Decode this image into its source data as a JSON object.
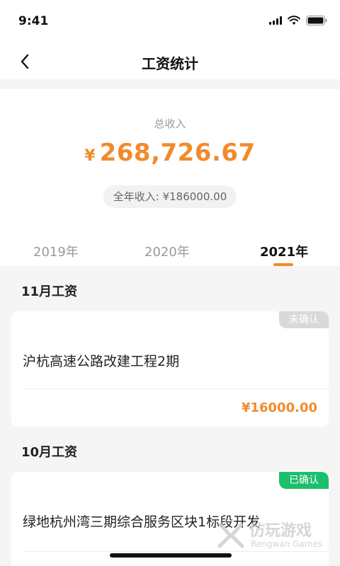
{
  "status_bar": {
    "time": "9:41"
  },
  "nav": {
    "title": "工资统计"
  },
  "summary": {
    "total_label": "总收入",
    "currency": "¥",
    "total_amount": "268,726.67",
    "year_income": "全年收入: ¥186000.00"
  },
  "tabs": [
    {
      "label": "2019年",
      "active": false
    },
    {
      "label": "2020年",
      "active": false
    },
    {
      "label": "2021年",
      "active": true
    }
  ],
  "colors": {
    "accent": "#f28a2c",
    "confirmed": "#1cbf6b",
    "pending": "#d9d9d9"
  },
  "sections": [
    {
      "title": "11月工资",
      "card": {
        "status": "未确认",
        "project": "沪杭高速公路改建工程2期",
        "amount": "¥16000.00"
      }
    },
    {
      "title": "10月工资",
      "card": {
        "status": "已确认",
        "project": "绿地杭州湾三期综合服务区块1标段开发"
      }
    }
  ],
  "watermark": {
    "text": "仿玩游戏",
    "sub": "Rengwan Games"
  }
}
